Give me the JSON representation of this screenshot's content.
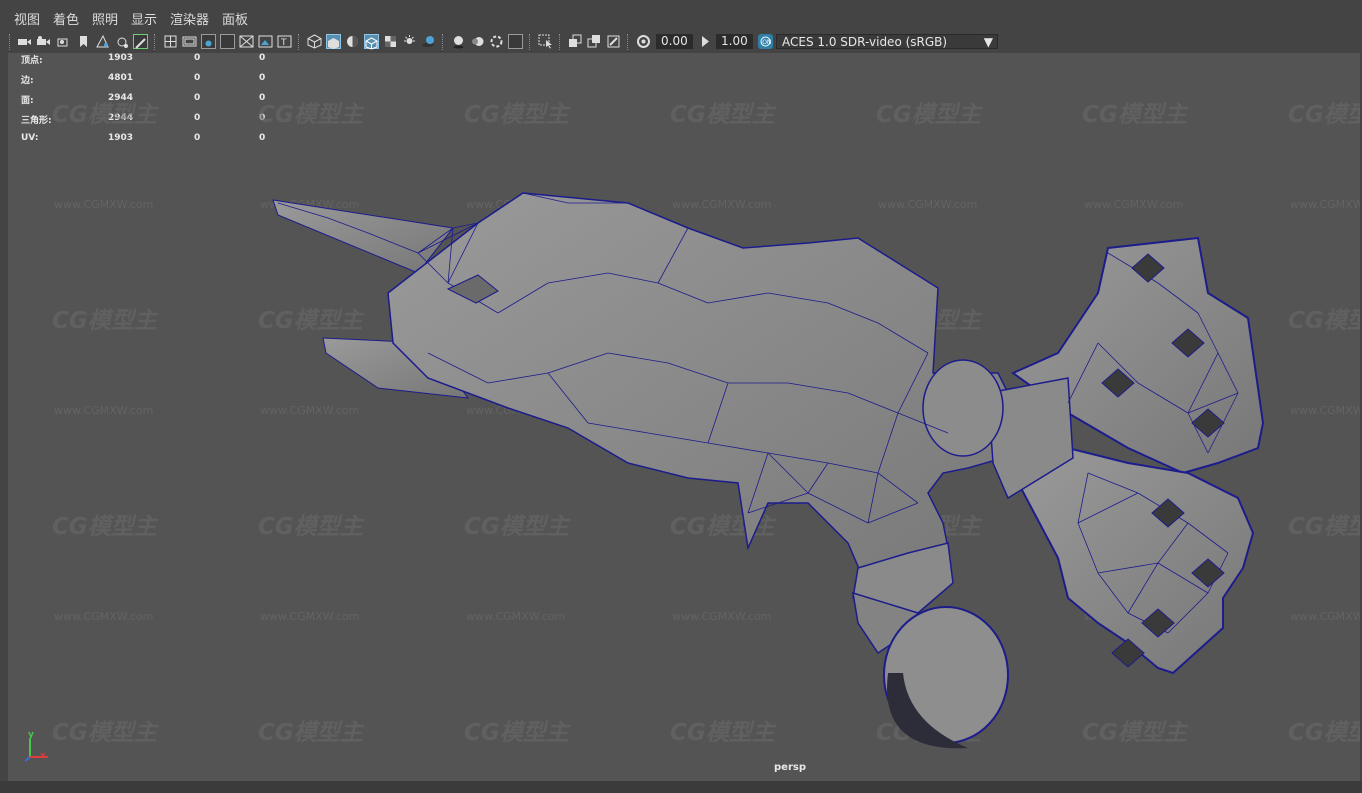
{
  "menu": [
    "视图",
    "着色",
    "照明",
    "显示",
    "渲染器",
    "面板"
  ],
  "toolbar": {
    "exposure_value": "0.00",
    "gamma_value": "1.00",
    "color_space": "ACES 1.0 SDR-video (sRGB)",
    "icons": [
      "camera-icon",
      "camera-attributes-icon",
      "bookmark-icon",
      "image-plane-icon",
      "grid-icon",
      "film-gate-icon",
      "resolution-gate-icon",
      "gate-mask-icon",
      "field-chart-icon",
      "safe-action-icon",
      "safe-title-icon",
      "wireframe-icon",
      "smooth-shade-icon",
      "flat-shade-icon",
      "wireframe-on-shaded-icon",
      "xray-icon",
      "textured-icon",
      "lights-icon",
      "shadows-icon",
      "ambient-occlusion-icon",
      "motion-blur-icon",
      "anti-aliasing-icon",
      "depth-of-field-icon",
      "isolate-select-icon",
      "xray-joints-icon",
      "xray-active-icon",
      "exposure-icon",
      "gamma-icon",
      "color-management-icon",
      "dropdown-arrow-icon"
    ]
  },
  "hud": {
    "rows": [
      {
        "label": "顶点:",
        "v1": "1903",
        "v2": "0",
        "v3": "0"
      },
      {
        "label": "边:",
        "v1": "4801",
        "v2": "0",
        "v3": "0"
      },
      {
        "label": "面:",
        "v1": "2944",
        "v2": "0",
        "v3": "0"
      },
      {
        "label": "三角形:",
        "v1": "2944",
        "v2": "0",
        "v3": "0"
      },
      {
        "label": "UV:",
        "v1": "1903",
        "v2": "0",
        "v3": "0"
      }
    ]
  },
  "viewport": {
    "camera_label": "persp",
    "axis_y": "y",
    "axis_x": "x"
  },
  "watermark": {
    "logo": "CG模型主",
    "url": "www.CGMXW.com"
  },
  "colors": {
    "viewport_bg": "#545454",
    "mesh_fill": "#8c8c8c",
    "mesh_wire": "#1c1c8c",
    "ui_bg": "#444444"
  }
}
